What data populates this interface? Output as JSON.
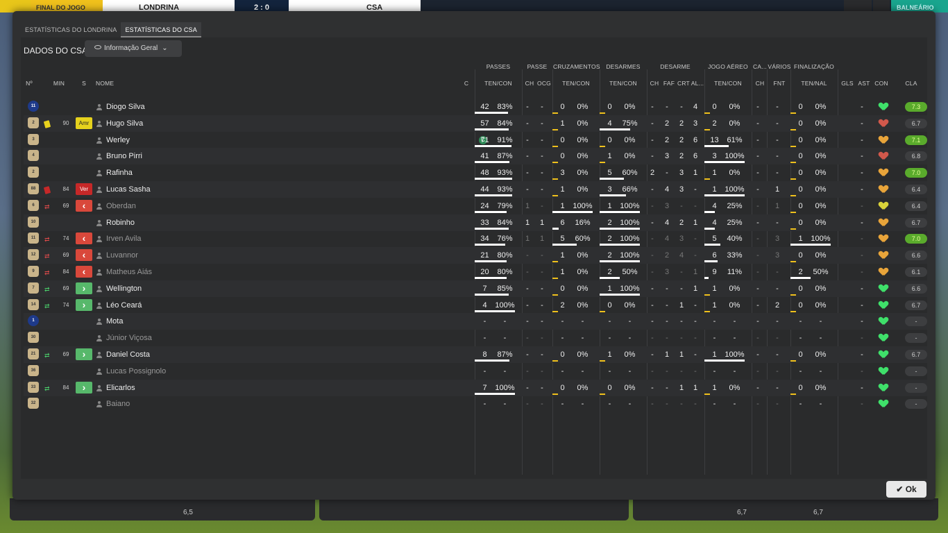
{
  "topbar": {
    "left_label": "FINAL DO JOGO",
    "home_team": "LONDRINA",
    "score": "2 : 0",
    "away_team": "CSA",
    "right_label": "BALNEÁRIO"
  },
  "bottombar": {
    "v1": "6,5",
    "v2": "6,7",
    "v3": "6,7"
  },
  "tabs": [
    {
      "label": "ESTATÍSTICAS DO LONDRINA",
      "active": false
    },
    {
      "label": "ESTATÍSTICAS DO CSA",
      "active": true
    }
  ],
  "section_title": "DADOS DO CSA",
  "view_select": {
    "label": "Informação Geral"
  },
  "group_headers": {
    "passes": "PASSES",
    "passe": "PASSE",
    "cruzamentos": "CRUZAMENTOS",
    "desarmes": "DESARMES",
    "desarme": "DESARME",
    "jogo_aereo": "JOGO AÉREO",
    "ca": "CA...",
    "varios": "VÁRIOS",
    "finalizacao": "FINALIZAÇÃO"
  },
  "columns": {
    "no": "Nº",
    "min": "MIN",
    "s": "S",
    "nome": "NOME",
    "c": "C",
    "passes": "TEN/CON",
    "passe_ch": "CH",
    "passe_ocg": "OCG",
    "cruz": "TEN/CON",
    "des": "TEN/CON",
    "dch": "CH",
    "faf": "FAF",
    "crt": "CRT",
    "al": "AL...",
    "aer": "TEN/CON",
    "ca_ch": "CH",
    "fnt": "FNT",
    "fin": "TEN/NAL",
    "gls": "GLS",
    "ast": "AST",
    "con": "CON",
    "cla": "CLA"
  },
  "colors": {
    "good_rating": "#5aab2c",
    "heart_green": "#3fe06a",
    "heart_orange": "#e8a43a",
    "heart_red": "#d1584b"
  },
  "players": [
    {
      "no": "11",
      "gk": true,
      "ev": "",
      "min": "",
      "s": "",
      "name": "Diogo Silva",
      "dim": false,
      "cap": false,
      "pt": "42",
      "pc": "83%",
      "pf": 0.83,
      "pch": "-",
      "pocg": "-",
      "ct": "0",
      "cc": "0%",
      "cf": 0,
      "dt": "0",
      "dc": "0%",
      "df": 0,
      "dch": "-",
      "faf": "-",
      "crt": "-",
      "al": "4",
      "at": "0",
      "ac": "0%",
      "af": 0,
      "cach": "-",
      "fnt": "-",
      "ft": "0",
      "fc": "0%",
      "ff": 0,
      "gls": "",
      "ast": "-",
      "heart": "green",
      "cla": "7.3",
      "good": true
    },
    {
      "no": "2",
      "gk": false,
      "ev": "yellow",
      "min": "90",
      "s": "Amr",
      "name": "Hugo Silva",
      "dim": false,
      "cap": false,
      "pt": "57",
      "pc": "84%",
      "pf": 0.84,
      "pch": "-",
      "pocg": "-",
      "ct": "1",
      "cc": "0%",
      "cf": 0,
      "dt": "4",
      "dc": "75%",
      "df": 0.75,
      "dch": "-",
      "faf": "2",
      "crt": "2",
      "al": "3",
      "at": "2",
      "ac": "0%",
      "af": 0,
      "cach": "-",
      "fnt": "-",
      "ft": "0",
      "fc": "0%",
      "ff": 0,
      "gls": "",
      "ast": "-",
      "heart": "red",
      "cla": "6.7",
      "good": false
    },
    {
      "no": "3",
      "gk": false,
      "ev": "",
      "min": "",
      "s": "",
      "name": "Werley",
      "dim": false,
      "cap": true,
      "pt": "71",
      "pc": "91%",
      "pf": 0.91,
      "pch": "-",
      "pocg": "-",
      "ct": "0",
      "cc": "0%",
      "cf": 0,
      "dt": "0",
      "dc": "0%",
      "df": 0,
      "dch": "-",
      "faf": "2",
      "crt": "2",
      "al": "6",
      "at": "13",
      "ac": "61%",
      "af": 0.61,
      "cach": "-",
      "fnt": "-",
      "ft": "0",
      "fc": "0%",
      "ff": 0,
      "gls": "",
      "ast": "-",
      "heart": "orange",
      "cla": "7.1",
      "good": true
    },
    {
      "no": "4",
      "gk": false,
      "ev": "",
      "min": "",
      "s": "",
      "name": "Bruno Pirri",
      "dim": false,
      "cap": false,
      "pt": "41",
      "pc": "87%",
      "pf": 0.87,
      "pch": "-",
      "pocg": "-",
      "ct": "0",
      "cc": "0%",
      "cf": 0,
      "dt": "1",
      "dc": "0%",
      "df": 0,
      "dch": "-",
      "faf": "3",
      "crt": "2",
      "al": "6",
      "at": "3",
      "ac": "100%",
      "af": 1,
      "cach": "-",
      "fnt": "-",
      "ft": "0",
      "fc": "0%",
      "ff": 0,
      "gls": "",
      "ast": "-",
      "heart": "red",
      "cla": "6.8",
      "good": false
    },
    {
      "no": "2",
      "gk": false,
      "ev": "",
      "min": "",
      "s": "",
      "name": "Rafinha",
      "dim": false,
      "cap": false,
      "pt": "48",
      "pc": "93%",
      "pf": 0.93,
      "pch": "-",
      "pocg": "-",
      "ct": "3",
      "cc": "0%",
      "cf": 0,
      "dt": "5",
      "dc": "60%",
      "df": 0.6,
      "dch": "2",
      "faf": "-",
      "crt": "3",
      "al": "1",
      "at": "1",
      "ac": "0%",
      "af": 0,
      "cach": "-",
      "fnt": "-",
      "ft": "0",
      "fc": "0%",
      "ff": 0,
      "gls": "",
      "ast": "-",
      "heart": "orange",
      "cla": "7.0",
      "good": true
    },
    {
      "no": "88",
      "gk": false,
      "ev": "red",
      "min": "84",
      "s": "Ver",
      "name": "Lucas Sasha",
      "dim": false,
      "cap": false,
      "pt": "44",
      "pc": "93%",
      "pf": 0.93,
      "pch": "-",
      "pocg": "-",
      "ct": "1",
      "cc": "0%",
      "cf": 0,
      "dt": "3",
      "dc": "66%",
      "df": 0.66,
      "dch": "-",
      "faf": "4",
      "crt": "3",
      "al": "-",
      "at": "1",
      "ac": "100%",
      "af": 1,
      "cach": "-",
      "fnt": "1",
      "ft": "0",
      "fc": "0%",
      "ff": 0,
      "gls": "",
      "ast": "-",
      "heart": "orange",
      "cla": "6.4",
      "good": false
    },
    {
      "no": "6",
      "gk": false,
      "ev": "subout",
      "min": "69",
      "s": "out",
      "name": "Oberdan",
      "dim": true,
      "cap": false,
      "pt": "24",
      "pc": "79%",
      "pf": 0.79,
      "pch": "1",
      "pocg": "-",
      "ct": "1",
      "cc": "100%",
      "cf": 1,
      "dt": "1",
      "dc": "100%",
      "df": 1,
      "dch": "-",
      "faf": "3",
      "crt": "-",
      "al": "-",
      "at": "4",
      "ac": "25%",
      "af": 0.25,
      "cach": "-",
      "fnt": "1",
      "ft": "0",
      "fc": "0%",
      "ff": 0,
      "gls": "",
      "ast": "-",
      "heart": "yellow",
      "cla": "6.4",
      "good": false
    },
    {
      "no": "10",
      "gk": false,
      "ev": "",
      "min": "",
      "s": "",
      "name": "Robinho",
      "dim": false,
      "cap": false,
      "pt": "33",
      "pc": "84%",
      "pf": 0.84,
      "pch": "1",
      "pocg": "1",
      "ct": "6",
      "cc": "16%",
      "cf": 0.16,
      "dt": "2",
      "dc": "100%",
      "df": 1,
      "dch": "-",
      "faf": "4",
      "crt": "2",
      "al": "1",
      "at": "4",
      "ac": "25%",
      "af": 0.25,
      "cach": "-",
      "fnt": "-",
      "ft": "0",
      "fc": "0%",
      "ff": 0,
      "gls": "",
      "ast": "-",
      "heart": "orange",
      "cla": "6.7",
      "good": false
    },
    {
      "no": "11",
      "gk": false,
      "ev": "subout",
      "min": "74",
      "s": "out",
      "name": "Irven Avila",
      "dim": true,
      "cap": false,
      "pt": "34",
      "pc": "76%",
      "pf": 0.76,
      "pch": "1",
      "pocg": "1",
      "ct": "5",
      "cc": "60%",
      "cf": 0.6,
      "dt": "2",
      "dc": "100%",
      "df": 1,
      "dch": "-",
      "faf": "4",
      "crt": "3",
      "al": "-",
      "at": "5",
      "ac": "40%",
      "af": 0.4,
      "cach": "-",
      "fnt": "3",
      "ft": "1",
      "fc": "100%",
      "ff": 1,
      "gls": "",
      "ast": "-",
      "heart": "orange",
      "cla": "7.0",
      "good": true
    },
    {
      "no": "12",
      "gk": false,
      "ev": "subout",
      "min": "69",
      "s": "out",
      "name": "Luvannor",
      "dim": true,
      "cap": false,
      "pt": "21",
      "pc": "80%",
      "pf": 0.8,
      "pch": "-",
      "pocg": "-",
      "ct": "1",
      "cc": "0%",
      "cf": 0,
      "dt": "2",
      "dc": "100%",
      "df": 1,
      "dch": "-",
      "faf": "2",
      "crt": "4",
      "al": "-",
      "at": "6",
      "ac": "33%",
      "af": 0.33,
      "cach": "-",
      "fnt": "3",
      "ft": "0",
      "fc": "0%",
      "ff": 0,
      "gls": "",
      "ast": "-",
      "heart": "orange",
      "cla": "6.6",
      "good": false
    },
    {
      "no": "9",
      "gk": false,
      "ev": "subout",
      "min": "84",
      "s": "out",
      "name": "Matheus Aiás",
      "dim": true,
      "cap": false,
      "pt": "20",
      "pc": "80%",
      "pf": 0.8,
      "pch": "-",
      "pocg": "-",
      "ct": "1",
      "cc": "0%",
      "cf": 0,
      "dt": "2",
      "dc": "50%",
      "df": 0.5,
      "dch": "-",
      "faf": "3",
      "crt": "-",
      "al": "1",
      "at": "9",
      "ac": "11%",
      "af": 0.11,
      "cach": "-",
      "fnt": "-",
      "ft": "2",
      "fc": "50%",
      "ff": 0.5,
      "gls": "",
      "ast": "-",
      "heart": "orange",
      "cla": "6.1",
      "good": false
    },
    {
      "no": "7",
      "gk": false,
      "ev": "subin",
      "min": "69",
      "s": "in",
      "name": "Wellington",
      "dim": false,
      "cap": false,
      "pt": "7",
      "pc": "85%",
      "pf": 0.85,
      "pch": "-",
      "pocg": "-",
      "ct": "0",
      "cc": "0%",
      "cf": 0,
      "dt": "1",
      "dc": "100%",
      "df": 1,
      "dch": "-",
      "faf": "-",
      "crt": "-",
      "al": "1",
      "at": "1",
      "ac": "0%",
      "af": 0,
      "cach": "-",
      "fnt": "-",
      "ft": "0",
      "fc": "0%",
      "ff": 0,
      "gls": "",
      "ast": "-",
      "heart": "green",
      "cla": "6.6",
      "good": false
    },
    {
      "no": "14",
      "gk": false,
      "ev": "subin",
      "min": "74",
      "s": "in",
      "name": "Léo Ceará",
      "dim": false,
      "cap": false,
      "pt": "4",
      "pc": "100%",
      "pf": 1,
      "pch": "-",
      "pocg": "-",
      "ct": "2",
      "cc": "0%",
      "cf": 0,
      "dt": "0",
      "dc": "0%",
      "df": 0,
      "dch": "-",
      "faf": "-",
      "crt": "1",
      "al": "-",
      "at": "1",
      "ac": "0%",
      "af": 0,
      "cach": "-",
      "fnt": "2",
      "ft": "0",
      "fc": "0%",
      "ff": 0,
      "gls": "",
      "ast": "-",
      "heart": "green",
      "cla": "6.7",
      "good": false
    },
    {
      "no": "1",
      "gk": true,
      "ev": "",
      "min": "",
      "s": "",
      "name": "Mota",
      "dim": false,
      "cap": false,
      "pt": "-",
      "pc": "-",
      "pf": null,
      "pch": "-",
      "pocg": "-",
      "ct": "-",
      "cc": "-",
      "cf": null,
      "dt": "-",
      "dc": "-",
      "df": null,
      "dch": "-",
      "faf": "-",
      "crt": "-",
      "al": "-",
      "at": "-",
      "ac": "-",
      "af": null,
      "cach": "-",
      "fnt": "-",
      "ft": "-",
      "fc": "-",
      "ff": null,
      "gls": "",
      "ast": "-",
      "heart": "green",
      "cla": "-",
      "good": false
    },
    {
      "no": "30",
      "gk": false,
      "ev": "",
      "min": "",
      "s": "",
      "name": "Júnior Viçosa",
      "dim": true,
      "cap": false,
      "pt": "-",
      "pc": "-",
      "pf": null,
      "pch": "-",
      "pocg": "-",
      "ct": "-",
      "cc": "-",
      "cf": null,
      "dt": "-",
      "dc": "-",
      "df": null,
      "dch": "-",
      "faf": "-",
      "crt": "-",
      "al": "-",
      "at": "-",
      "ac": "-",
      "af": null,
      "cach": "-",
      "fnt": "-",
      "ft": "-",
      "fc": "-",
      "ff": null,
      "gls": "",
      "ast": "-",
      "heart": "green",
      "cla": "-",
      "good": false
    },
    {
      "no": "21",
      "gk": false,
      "ev": "subin",
      "min": "69",
      "s": "in",
      "name": "Daniel Costa",
      "dim": false,
      "cap": false,
      "pt": "8",
      "pc": "87%",
      "pf": 0.87,
      "pch": "-",
      "pocg": "-",
      "ct": "0",
      "cc": "0%",
      "cf": 0,
      "dt": "1",
      "dc": "0%",
      "df": 0,
      "dch": "-",
      "faf": "1",
      "crt": "1",
      "al": "-",
      "at": "1",
      "ac": "100%",
      "af": 1,
      "cach": "-",
      "fnt": "-",
      "ft": "0",
      "fc": "0%",
      "ff": 0,
      "gls": "",
      "ast": "-",
      "heart": "green",
      "cla": "6.7",
      "good": false
    },
    {
      "no": "36",
      "gk": false,
      "ev": "",
      "min": "",
      "s": "",
      "name": "Lucas Possignolo",
      "dim": true,
      "cap": false,
      "pt": "-",
      "pc": "-",
      "pf": null,
      "pch": "-",
      "pocg": "-",
      "ct": "-",
      "cc": "-",
      "cf": null,
      "dt": "-",
      "dc": "-",
      "df": null,
      "dch": "-",
      "faf": "-",
      "crt": "-",
      "al": "-",
      "at": "-",
      "ac": "-",
      "af": null,
      "cach": "-",
      "fnt": "-",
      "ft": "-",
      "fc": "-",
      "ff": null,
      "gls": "",
      "ast": "-",
      "heart": "green",
      "cla": "-",
      "good": false
    },
    {
      "no": "33",
      "gk": false,
      "ev": "subin",
      "min": "84",
      "s": "in",
      "name": "Elicarlos",
      "dim": false,
      "cap": false,
      "pt": "7",
      "pc": "100%",
      "pf": 1,
      "pch": "-",
      "pocg": "-",
      "ct": "0",
      "cc": "0%",
      "cf": 0,
      "dt": "0",
      "dc": "0%",
      "df": 0,
      "dch": "-",
      "faf": "-",
      "crt": "1",
      "al": "1",
      "at": "1",
      "ac": "0%",
      "af": 0,
      "cach": "-",
      "fnt": "-",
      "ft": "0",
      "fc": "0%",
      "ff": 0,
      "gls": "",
      "ast": "-",
      "heart": "green",
      "cla": "-",
      "good": false
    },
    {
      "no": "32",
      "gk": false,
      "ev": "",
      "min": "",
      "s": "",
      "name": "Baiano",
      "dim": true,
      "cap": false,
      "pt": "-",
      "pc": "-",
      "pf": null,
      "pch": "-",
      "pocg": "-",
      "ct": "-",
      "cc": "-",
      "cf": null,
      "dt": "-",
      "dc": "-",
      "df": null,
      "dch": "-",
      "faf": "-",
      "crt": "-",
      "al": "-",
      "at": "-",
      "ac": "-",
      "af": null,
      "cach": "-",
      "fnt": "-",
      "ft": "-",
      "fc": "-",
      "ff": null,
      "gls": "",
      "ast": "-",
      "heart": "green",
      "cla": "-",
      "good": false
    }
  ],
  "captain_label": "C",
  "ok_button": "Ok"
}
